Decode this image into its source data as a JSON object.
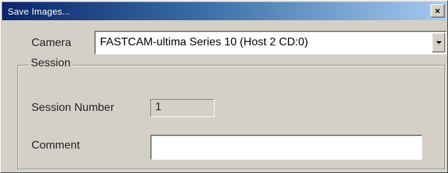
{
  "window": {
    "title": "Save Images...",
    "close_glyph": "×"
  },
  "camera": {
    "label": "Camera",
    "selected_value": "FASTCAM-ultima Series 10 (Host 2 CD:0)"
  },
  "session": {
    "group_title": "Session",
    "number_label": "Session Number",
    "number_value": "1",
    "comment_label": "Comment",
    "comment_value": ""
  },
  "icons": {
    "close": "close-icon",
    "dropdown": "chevron-down-icon"
  },
  "colors": {
    "face": "#d4d0c8",
    "title_active": "#0a246a",
    "title_gradient_end": "#a6caf0"
  }
}
